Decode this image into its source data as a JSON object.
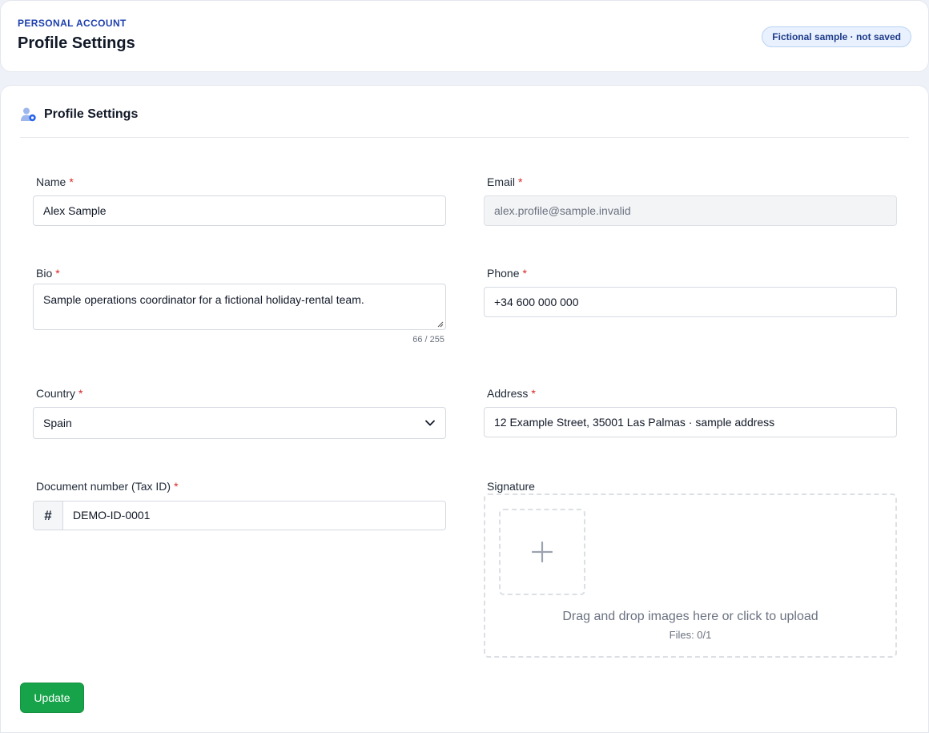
{
  "header": {
    "eyebrow": "PERSONAL ACCOUNT",
    "title": "Profile Settings",
    "badge": "Fictional sample · not saved"
  },
  "card": {
    "title": "Profile Settings",
    "icon": "user-gear-icon"
  },
  "form": {
    "required_marker": "*",
    "name": {
      "label": "Name",
      "value": "Alex Sample"
    },
    "email": {
      "label": "Email",
      "value": "alex.profile@sample.invalid"
    },
    "bio": {
      "label": "Bio",
      "value": "Sample operations coordinator for a fictional holiday-rental team.",
      "counter": "66 / 255"
    },
    "phone": {
      "label": "Phone",
      "value": "+34 600 000 000"
    },
    "country": {
      "label": "Country",
      "value": "Spain"
    },
    "address": {
      "label": "Address",
      "value": "12 Example Street, 35001 Las Palmas · sample address"
    },
    "document": {
      "label": "Document number (Tax ID)",
      "prefix": "#",
      "value": "DEMO-ID-0001"
    },
    "signature": {
      "label": "Signature",
      "dropzone_text": "Drag and drop images here or click to upload",
      "files": "Files: 0/1"
    }
  },
  "actions": {
    "update_label": "Update"
  },
  "colors": {
    "accent": "#1e40af",
    "required": "#dc2626",
    "primary_button": "#16a34a",
    "badge_bg": "#e8f1fd"
  }
}
